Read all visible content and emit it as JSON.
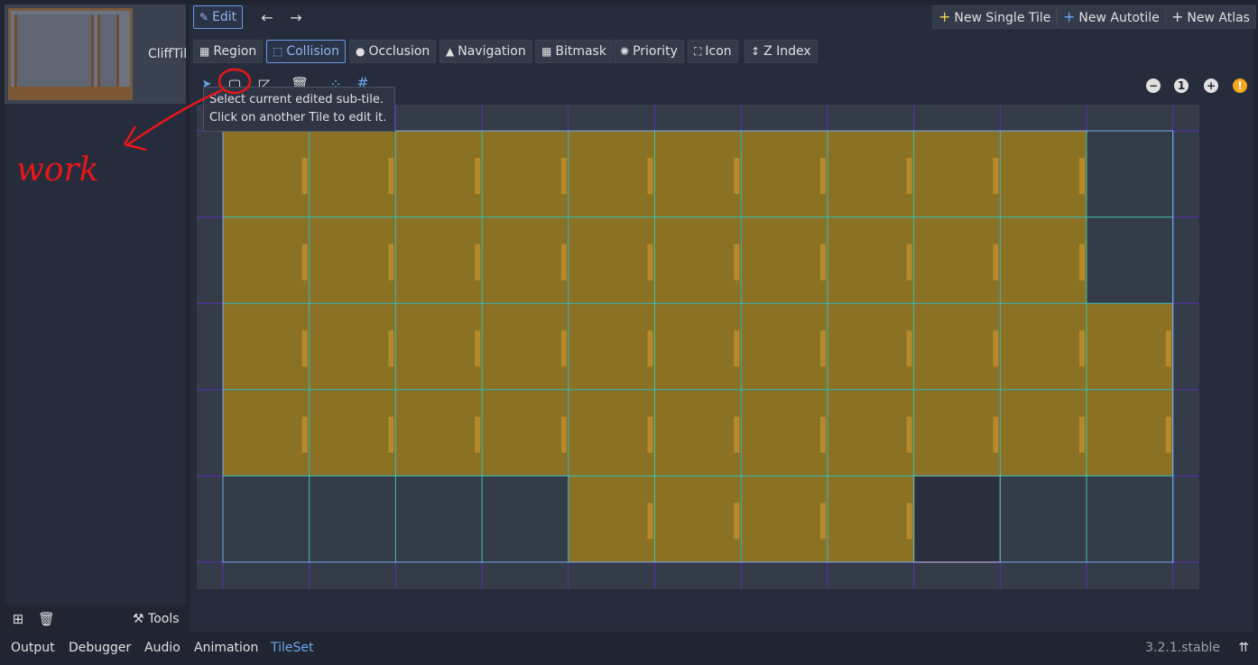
{
  "left": {
    "thumbnail_label": "CliffTil",
    "tools_label": "Tools",
    "add_icon": "add-icon",
    "delete_icon": "trash-icon"
  },
  "toolbar": {
    "edit_label": "Edit",
    "new_single_tile": "New Single Tile",
    "new_autotile": "New Autotile",
    "new_atlas": "New Atlas"
  },
  "modes": [
    {
      "label": "Region",
      "icon": "region-icon",
      "active": false
    },
    {
      "label": "Collision",
      "icon": "collision-icon",
      "active": true
    },
    {
      "label": "Occlusion",
      "icon": "occlusion-icon",
      "active": false
    },
    {
      "label": "Navigation",
      "icon": "navigation-icon",
      "active": false
    },
    {
      "label": "Bitmask",
      "icon": "bitmask-icon",
      "active": false
    },
    {
      "label": "Priority",
      "icon": "priority-icon",
      "active": false
    },
    {
      "label": "Icon",
      "icon": "icon-icon",
      "active": false
    },
    {
      "label": "Z Index",
      "icon": "z-index-icon",
      "active": false
    }
  ],
  "tooltip": {
    "line1": "Select current edited sub-tile.",
    "line2": "Click on another Tile to edit it."
  },
  "annotation": {
    "handwritten": "work",
    "color": "#e8161b"
  },
  "bottom_tabs": [
    "Output",
    "Debugger",
    "Audio",
    "Animation",
    "TileSet"
  ],
  "active_bottom_tab": "TileSet",
  "version": "3.2.1.stable",
  "colors": {
    "accent": "#699ce8",
    "tile_fill": "#8a7123",
    "tile_border": "#c9962f",
    "grid_line": "#3cc9a4",
    "outer_grid": "#5a2fb4",
    "selected": "#e05a5a"
  },
  "grid": {
    "cols": 11,
    "rows": 5
  }
}
